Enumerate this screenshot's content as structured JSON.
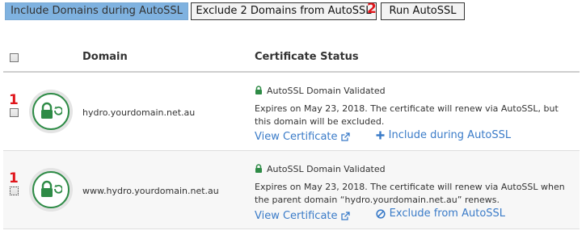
{
  "toolbar": {
    "include_label": "Include Domains during AutoSSL",
    "exclude_label": "Exclude 2 Domains from AutoSSL",
    "run_label": "Run AutoSSL",
    "exclude_badge": "2"
  },
  "table": {
    "col_domain": "Domain",
    "col_status": "Certificate Status"
  },
  "rows": [
    {
      "badge": "1",
      "domain": "hydro.yourdomain.net.au",
      "status": "AutoSSL Domain Validated",
      "expires": "Expires on May 23, 2018. The certificate will renew via AutoSSL, but this domain will be excluded.",
      "view_cert": "View Certificate",
      "action": "Include during AutoSSL"
    },
    {
      "badge": "1",
      "domain": "www.hydro.yourdomain.net.au",
      "status": "AutoSSL Domain Validated",
      "expires": "Expires on May 23, 2018. The certificate will renew via AutoSSL when the parent domain “hydro.yourdomain.net.au” renews.",
      "view_cert": "View Certificate",
      "action": "Exclude from AutoSSL"
    }
  ],
  "colors": {
    "accent_green": "#2e8b46",
    "link_blue": "#3a7bc8",
    "badge_red": "#e0161c",
    "include_button": "#7fb2e0"
  }
}
